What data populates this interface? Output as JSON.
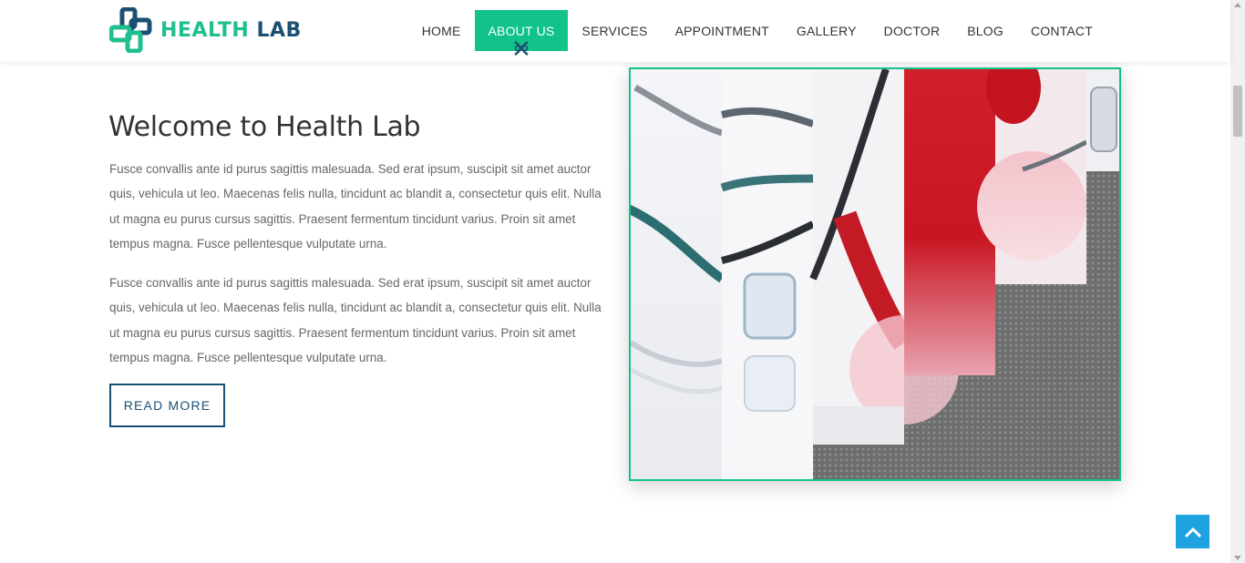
{
  "brand": {
    "name_part1": "HEALTH",
    "name_part2": "LAB",
    "colors": {
      "green": "#1fbf8f",
      "navy": "#1b4f72"
    }
  },
  "nav": {
    "items": [
      {
        "label": "HOME",
        "active": false
      },
      {
        "label": "ABOUT US",
        "active": true
      },
      {
        "label": "SERVICES",
        "active": false
      },
      {
        "label": "APPOINTMENT",
        "active": false
      },
      {
        "label": "GALLERY",
        "active": false
      },
      {
        "label": "DOCTOR",
        "active": false
      },
      {
        "label": "BLOG",
        "active": false
      },
      {
        "label": "CONTACT",
        "active": false
      }
    ],
    "active_color": "#12c28b"
  },
  "about": {
    "title": "Welcome to Health Lab",
    "paragraphs": [
      "Fusce convallis ante id purus sagittis malesuada. Sed erat ipsum, suscipit sit amet auctor quis, vehicula ut leo. Maecenas felis nulla, tincidunt ac blandit a, consectetur quis elit. Nulla ut magna eu purus cursus sagittis. Praesent fermentum tincidunt varius. Proin sit amet tempus magna. Fusce pellentesque vulputate urna.",
      "Fusce convallis ante id purus sagittis malesuada. Sed erat ipsum, suscipit sit amet auctor quis, vehicula ut leo. Maecenas felis nulla, tincidunt ac blandit a, consectetur quis elit. Nulla ut magna eu purus cursus sagittis. Praesent fermentum tincidunt varius. Proin sit amet tempus magna. Fusce pellentesque vulputate urna."
    ],
    "button_label": "READ MORE"
  },
  "image": {
    "subject": "stethoscope-photo",
    "border_color": "#12c28b"
  },
  "icons": {
    "logo": "medical-cross-logo-icon",
    "nav_active": "dna-icon",
    "back_to_top": "chevron-up-icon"
  }
}
